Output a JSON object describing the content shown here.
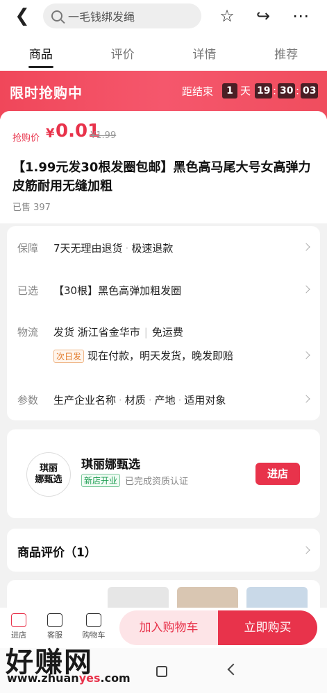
{
  "search": {
    "placeholder": "一毛钱绑发绳"
  },
  "tabs": [
    "商品",
    "评价",
    "详情",
    "推荐"
  ],
  "flash": {
    "title": "限时抢购中",
    "ends_label": "距结束",
    "days": "1",
    "days_unit": "天",
    "hours": "19",
    "minutes": "30",
    "seconds": "03",
    "separator": ":"
  },
  "product": {
    "price_label": "抢购价",
    "currency": "¥",
    "price": "0.01",
    "original_price": "¥1.99",
    "title": "【1.99元发30根发圈包邮】黑色高马尾大号女高弹力皮筋耐用无缝加粗",
    "sold": "已售 397"
  },
  "info": {
    "guarantee": {
      "label": "保障",
      "items": [
        "7天无理由退货",
        "极速退款"
      ]
    },
    "selected": {
      "label": "已选",
      "value": "【30根】黑色高弹加粗发圈"
    },
    "shipping": {
      "label": "物流",
      "from": "发货 浙江省金华市",
      "fee": "免运费",
      "tag": "次日发",
      "promise": "现在付款，明天发货，晚发即赔"
    },
    "params": {
      "label": "参数",
      "items": [
        "生产企业名称",
        "材质",
        "产地",
        "适用对象"
      ]
    }
  },
  "shop": {
    "logo_line1": "琪丽",
    "logo_line2": "娜甄选",
    "name": "琪丽娜甄选",
    "badge": "新店开业",
    "verified": "已完成资质认证",
    "enter": "进店"
  },
  "reviews": {
    "title": "商品评价（1）"
  },
  "bottom": {
    "shop": "进店",
    "service": "客服",
    "cart": "购物车",
    "add_to_cart": "加入购物车",
    "buy_now": "立即购买"
  },
  "watermark": {
    "brand": "好赚网",
    "url_prefix": "www.zhuan",
    "url_mid": "yes",
    "url_suffix": ".com"
  },
  "colors": {
    "accent": "#e8334b",
    "banner": "#f5576c"
  }
}
